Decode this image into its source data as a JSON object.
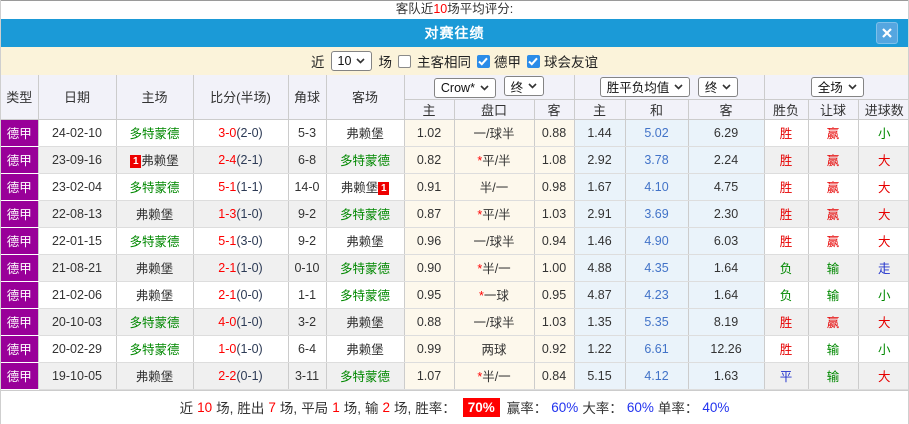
{
  "top_note": {
    "pre": "客队近",
    "num": "10",
    "post": "场平均评分:"
  },
  "titlebar": {
    "title": "对赛往绩"
  },
  "filter": {
    "near": "近",
    "count": "10",
    "games": "场",
    "same": "主客相同",
    "league": "德甲",
    "friendly": "球会友谊"
  },
  "table": {
    "headers": {
      "type": "类型",
      "date": "日期",
      "home": "主场",
      "score": "比分(半场)",
      "corner": "角球",
      "away": "客场",
      "odds_source": "Crow*",
      "odds_final": "终",
      "h": "主",
      "handicap": "盘口",
      "a": "客",
      "wdl_title": "胜平负均值",
      "wdl_final": "终",
      "w": "主",
      "d": "和",
      "l": "客",
      "scope": "全场",
      "res": "胜负",
      "let": "让球",
      "goal": "进球数"
    },
    "rows": [
      {
        "league": "德甲",
        "date": "24-02-10",
        "home_pre": "",
        "home": "多特蒙德",
        "home_post": "",
        "ft": "3-0",
        "ht": "(2-0)",
        "corner": "5-3",
        "away_pre": "",
        "away": "弗赖堡",
        "away_post": "",
        "h1": "1.02",
        "star": "",
        "pan": "一/球半",
        "a1": "0.88",
        "w": "1.44",
        "d": "5.02",
        "l": "6.29",
        "res": "胜",
        "rang": "赢",
        "goal": "小"
      },
      {
        "league": "德甲",
        "date": "23-09-16",
        "home_pre": "1",
        "home": "弗赖堡",
        "home_post": "",
        "ft": "2-4",
        "ht": "(2-1)",
        "corner": "6-8",
        "away_pre": "",
        "away": "多特蒙德",
        "away_post": "",
        "h1": "0.82",
        "star": "*",
        "pan": "平/半",
        "a1": "1.08",
        "w": "2.92",
        "d": "3.78",
        "l": "2.24",
        "res": "胜",
        "rang": "赢",
        "goal": "大"
      },
      {
        "league": "德甲",
        "date": "23-02-04",
        "home_pre": "",
        "home": "多特蒙德",
        "home_post": "",
        "ft": "5-1",
        "ht": "(1-1)",
        "corner": "14-0",
        "away_pre": "",
        "away": "弗赖堡",
        "away_post": "1",
        "h1": "0.91",
        "star": "",
        "pan": "半/一",
        "a1": "0.98",
        "w": "1.67",
        "d": "4.10",
        "l": "4.75",
        "res": "胜",
        "rang": "赢",
        "goal": "大"
      },
      {
        "league": "德甲",
        "date": "22-08-13",
        "home_pre": "",
        "home": "弗赖堡",
        "home_post": "",
        "ft": "1-3",
        "ht": "(1-0)",
        "corner": "9-2",
        "away_pre": "",
        "away": "多特蒙德",
        "away_post": "",
        "h1": "0.87",
        "star": "*",
        "pan": "平/半",
        "a1": "1.03",
        "w": "2.91",
        "d": "3.69",
        "l": "2.30",
        "res": "胜",
        "rang": "赢",
        "goal": "大"
      },
      {
        "league": "德甲",
        "date": "22-01-15",
        "home_pre": "",
        "home": "多特蒙德",
        "home_post": "",
        "ft": "5-1",
        "ht": "(3-0)",
        "corner": "9-2",
        "away_pre": "",
        "away": "弗赖堡",
        "away_post": "",
        "h1": "0.96",
        "star": "",
        "pan": "一/球半",
        "a1": "0.94",
        "w": "1.46",
        "d": "4.90",
        "l": "6.03",
        "res": "胜",
        "rang": "赢",
        "goal": "大"
      },
      {
        "league": "德甲",
        "date": "21-08-21",
        "home_pre": "",
        "home": "弗赖堡",
        "home_post": "",
        "ft": "2-1",
        "ht": "(1-0)",
        "corner": "0-10",
        "away_pre": "",
        "away": "多特蒙德",
        "away_post": "",
        "h1": "0.90",
        "star": "*",
        "pan": "半/一",
        "a1": "1.00",
        "w": "4.88",
        "d": "4.35",
        "l": "1.64",
        "res": "负",
        "rang": "输",
        "goal": "走"
      },
      {
        "league": "德甲",
        "date": "21-02-06",
        "home_pre": "",
        "home": "弗赖堡",
        "home_post": "",
        "ft": "2-1",
        "ht": "(0-0)",
        "corner": "1-1",
        "away_pre": "",
        "away": "多特蒙德",
        "away_post": "",
        "h1": "0.95",
        "star": "*",
        "pan": "一球",
        "a1": "0.95",
        "w": "4.87",
        "d": "4.23",
        "l": "1.64",
        "res": "负",
        "rang": "输",
        "goal": "小"
      },
      {
        "league": "德甲",
        "date": "20-10-03",
        "home_pre": "",
        "home": "多特蒙德",
        "home_post": "",
        "ft": "4-0",
        "ht": "(1-0)",
        "corner": "3-2",
        "away_pre": "",
        "away": "弗赖堡",
        "away_post": "",
        "h1": "0.88",
        "star": "",
        "pan": "一/球半",
        "a1": "1.03",
        "w": "1.35",
        "d": "5.35",
        "l": "8.19",
        "res": "胜",
        "rang": "赢",
        "goal": "大"
      },
      {
        "league": "德甲",
        "date": "20-02-29",
        "home_pre": "",
        "home": "多特蒙德",
        "home_post": "",
        "ft": "1-0",
        "ht": "(1-0)",
        "corner": "6-4",
        "away_pre": "",
        "away": "弗赖堡",
        "away_post": "",
        "h1": "0.99",
        "star": "",
        "pan": "两球",
        "a1": "0.92",
        "w": "1.22",
        "d": "6.61",
        "l": "12.26",
        "res": "胜",
        "rang": "输",
        "goal": "小"
      },
      {
        "league": "德甲",
        "date": "19-10-05",
        "home_pre": "",
        "home": "弗赖堡",
        "home_post": "",
        "ft": "2-2",
        "ht": "(0-1)",
        "corner": "3-11",
        "away_pre": "",
        "away": "多特蒙德",
        "away_post": "",
        "h1": "1.07",
        "star": "*",
        "pan": "半/一",
        "a1": "0.84",
        "w": "5.15",
        "d": "4.12",
        "l": "1.63",
        "res": "平",
        "rang": "输",
        "goal": "大"
      }
    ]
  },
  "summary": {
    "near": "近",
    "total": "10",
    "g1": "场,",
    "wins_label": "胜出",
    "wins": "7",
    "g2": "场,",
    "draw_label": "平局",
    "draws": "1",
    "g3": "场,",
    "lose_label": "输",
    "loses": "2",
    "g4": "场,",
    "rate_label": "胜率：",
    "win_rate": "70%",
    "asian_label": "赢率：",
    "asian_rate": "60%",
    "ou_label": "大率：",
    "ou_rate": "60%",
    "odd_label": "单率：",
    "odd_rate": "40%"
  }
}
